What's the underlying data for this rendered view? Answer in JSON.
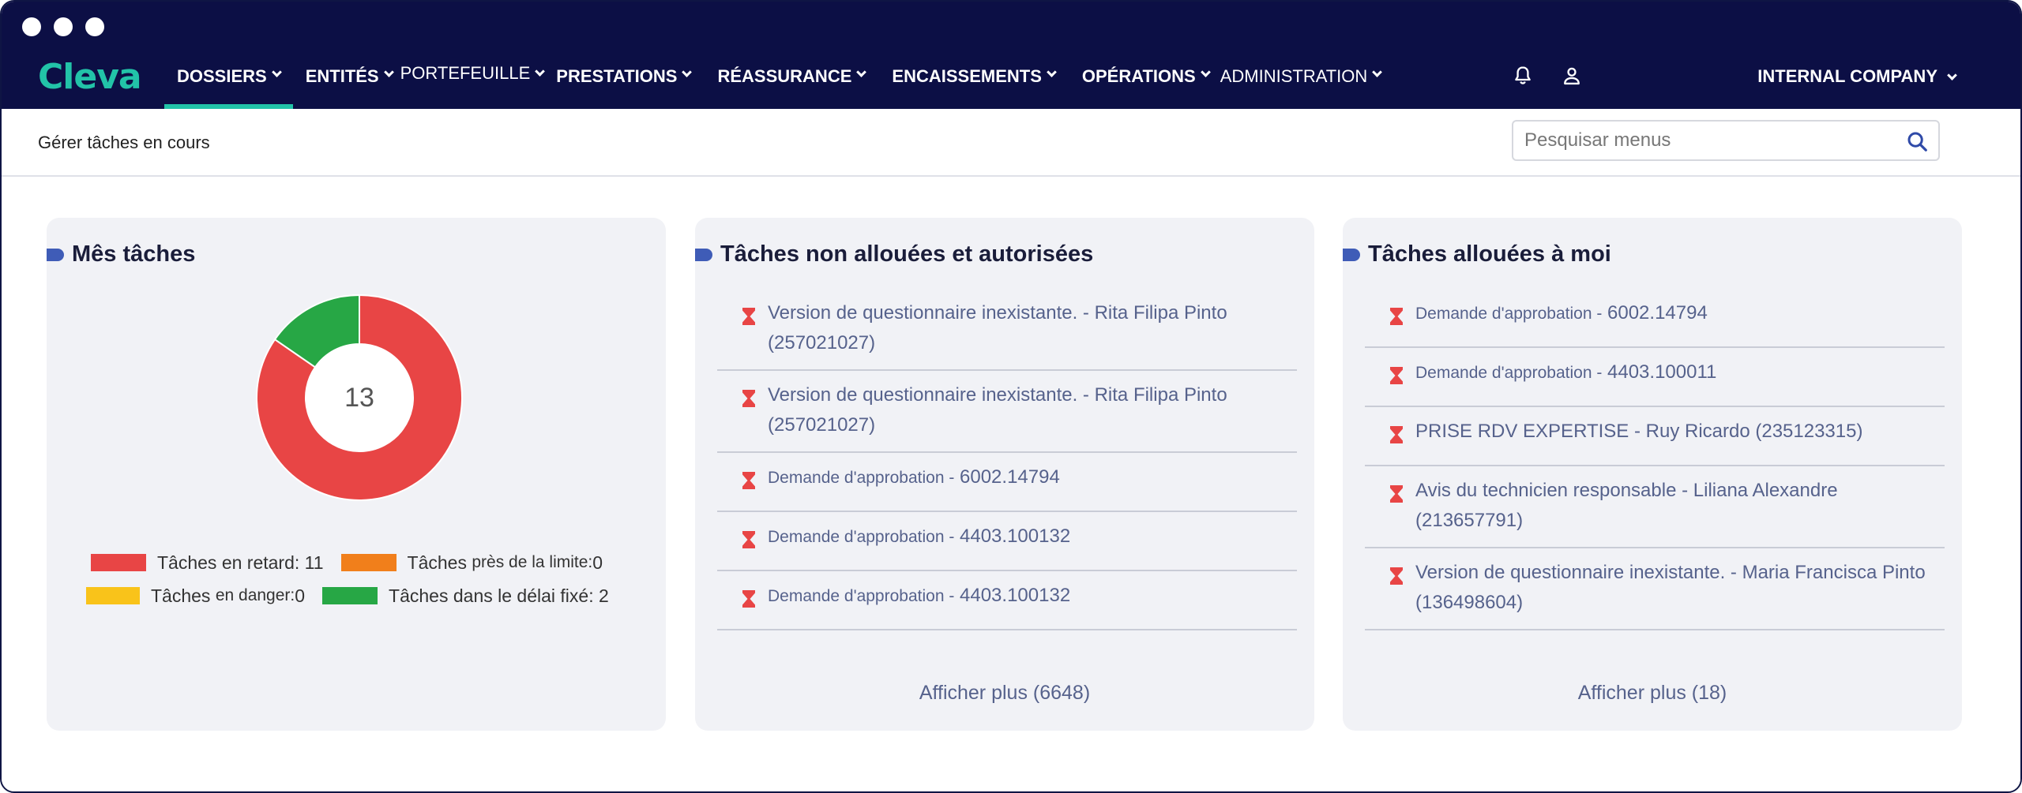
{
  "app": {
    "logo": "Cleva"
  },
  "nav": {
    "items": [
      {
        "label": "DOSSIERS",
        "active": true,
        "light": false
      },
      {
        "label": "ENTITÉS",
        "active": false,
        "light": false
      },
      {
        "label": "PORTEFEUILLE",
        "active": false,
        "light": true
      },
      {
        "label": "PRESTATIONS",
        "active": false,
        "light": false
      },
      {
        "label": "RÉASSURANCE",
        "active": false,
        "light": false
      },
      {
        "label": "ENCAISSEMENTS",
        "active": false,
        "light": false
      },
      {
        "label": "OPÉRATIONS",
        "active": false,
        "light": false
      },
      {
        "label": "ADMINISTRATION",
        "active": false,
        "light": true
      }
    ],
    "company": "INTERNAL COMPANY",
    "icons": [
      "bell-icon",
      "user-icon"
    ]
  },
  "subbar": {
    "breadcrumb": "Gérer tâches en cours",
    "search_placeholder": "Pesquisar menus"
  },
  "colors": {
    "navbar": "#0c0f45",
    "accent": "#22c3a8",
    "late": "#e84545",
    "near_limit": "#f17f1b",
    "danger": "#f9c31a",
    "on_time": "#27a745",
    "link": "#56628c"
  },
  "my_tasks": {
    "title": "Mês tâches",
    "total": "13",
    "legend": {
      "late_label": "Tâches en retard:",
      "late_value": "11",
      "near_label_a": "Tâches",
      "near_label_b": "près de la limite:",
      "near_value": "0",
      "danger_label_a": "Tâches",
      "danger_label_b": "en danger:",
      "danger_value": "0",
      "ontime_label": "Tâches dans le délai fixé:",
      "ontime_value": "2"
    }
  },
  "chart_data": {
    "type": "pie",
    "categories": [
      "Tâches en retard",
      "Tâches près de la limite",
      "Tâches en danger",
      "Tâches dans le délai fixé"
    ],
    "values": [
      11,
      0,
      0,
      2
    ],
    "colors": [
      "#e84545",
      "#f17f1b",
      "#f9c31a",
      "#27a745"
    ],
    "center_label": "13"
  },
  "unassigned": {
    "title": "Tâches non allouées et autorisées",
    "tasks": [
      {
        "pre": "",
        "main": "Version de questionnaire inexistante. - Rita Filipa Pinto (257021027)"
      },
      {
        "pre": "",
        "main": "Version de questionnaire inexistante. - Rita Filipa Pinto (257021027)"
      },
      {
        "pre": "Demande d'approbation -",
        "main": "6002.14794"
      },
      {
        "pre": "Demande d'approbation -",
        "main": "4403.100132"
      },
      {
        "pre": "Demande d'approbation -",
        "main": "4403.100132"
      }
    ],
    "show_more": "Afficher plus (6648)"
  },
  "assigned": {
    "title": "Tâches allouées à moi",
    "tasks": [
      {
        "pre": "Demande d'approbation -",
        "main": "6002.14794"
      },
      {
        "pre": "Demande d'approbation -",
        "main": "4403.100011"
      },
      {
        "pre": "",
        "main": "PRISE RDV EXPERTISE - Ruy Ricardo (235123315)"
      },
      {
        "pre": "",
        "main": "Avis du technicien responsable - Liliana Alexandre (213657791)"
      },
      {
        "pre": "",
        "main": "Version de questionnaire inexistante. - Maria Francisca Pinto (136498604)"
      }
    ],
    "show_more": "Afficher plus (18)"
  }
}
